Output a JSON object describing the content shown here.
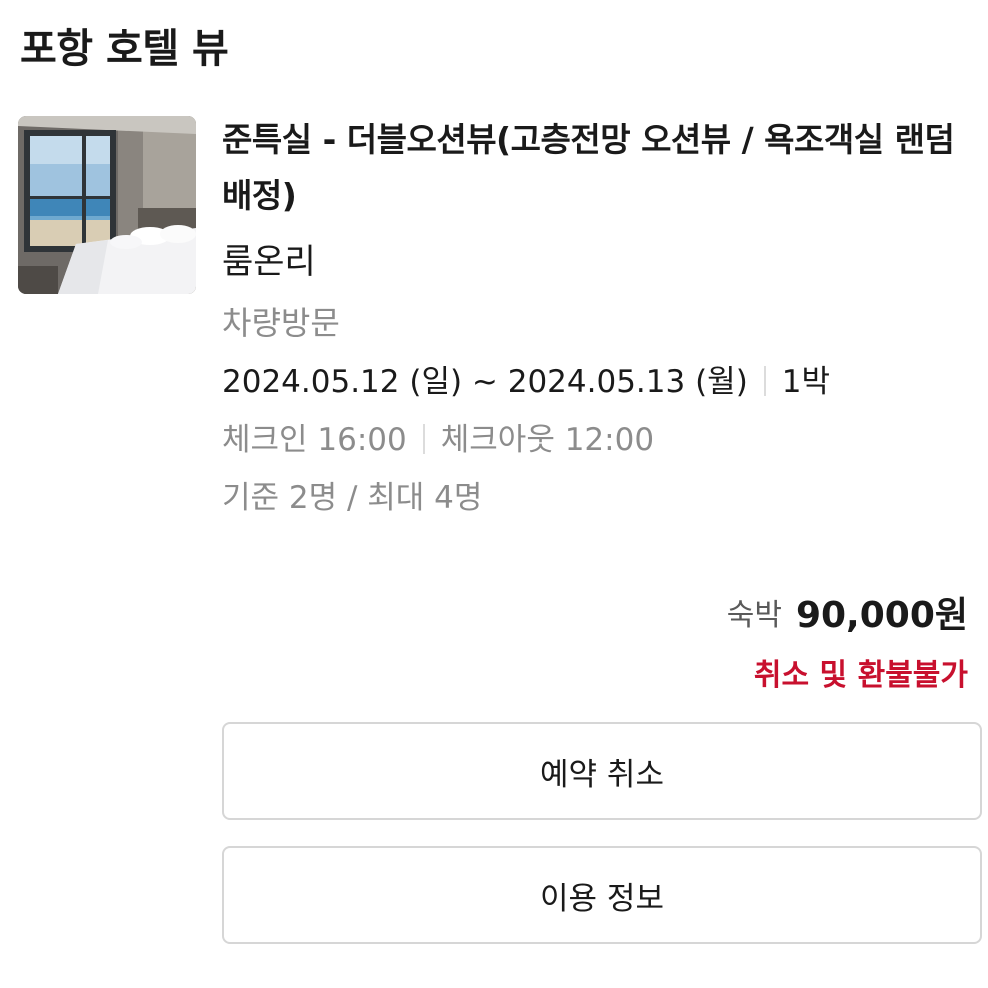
{
  "hotel": {
    "name": "포항 호텔 뷰"
  },
  "room": {
    "name": "준특실 - 더블오션뷰(고층전망 오션뷰 / 욕조객실 랜덤배정)",
    "type": "룸온리",
    "visit_type": "차량방문",
    "date_range": "2024.05.12 (일) ~ 2024.05.13 (월)",
    "nights": "1박",
    "checkin": "체크인 16:00",
    "checkout": "체크아웃 12:00",
    "occupancy": "기준 2명 / 최대 4명"
  },
  "price": {
    "label": "숙박",
    "amount": "90,000원"
  },
  "refund_notice": "취소 및 환불불가",
  "buttons": {
    "cancel": "예약 취소",
    "info": "이용 정보"
  },
  "colors": {
    "refund_notice": "#c8102e",
    "secondary_text": "#8c8c8c",
    "button_border": "#d6d6d6"
  }
}
